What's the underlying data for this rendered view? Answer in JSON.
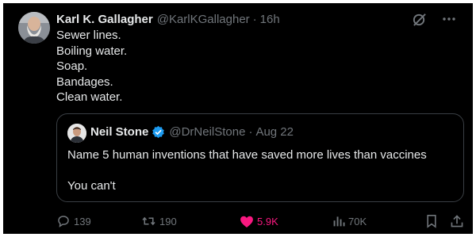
{
  "post": {
    "author_name": "Karl K. Gallagher",
    "author_handle": "@KarlKGallagher",
    "separator": "·",
    "time": "16h",
    "lines": [
      "Sewer lines.",
      "Boiling water.",
      "Soap.",
      "Bandages.",
      "Clean water."
    ]
  },
  "quote": {
    "author_name": "Neil Stone",
    "author_handle": "@DrNeilStone",
    "separator": "·",
    "date": "Aug 22",
    "line1": "Name 5 human inventions that have saved more lives than vaccines",
    "line2": "You can't"
  },
  "actions": {
    "replies": "139",
    "reposts": "190",
    "likes": "5.9K",
    "views": "70K"
  },
  "colors": {
    "background": "#000000",
    "text": "#e7e9ea",
    "muted": "#71767b",
    "like": "#f91880",
    "verified": "#1d9bf0"
  },
  "icons": [
    "grok-icon",
    "more-icon",
    "verified-badge-icon",
    "reply-icon",
    "repost-icon",
    "like-icon",
    "views-icon",
    "bookmark-icon",
    "share-icon"
  ]
}
